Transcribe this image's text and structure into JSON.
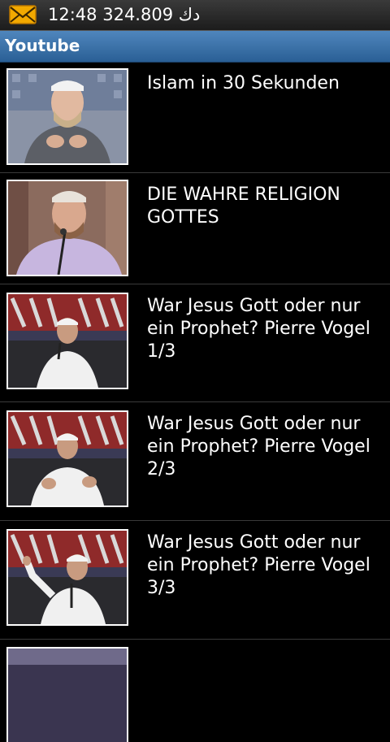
{
  "status_bar": {
    "time": "12:48",
    "extra": "دك 324.809",
    "notification_icon": "mail-icon"
  },
  "app": {
    "title": "Youtube"
  },
  "videos": [
    {
      "title": "Islam in 30 Sekunden"
    },
    {
      "title": "DIE WAHRE RELIGION GOTTES"
    },
    {
      "title": "War Jesus Gott oder nur ein Prophet? Pierre Vogel 1/3"
    },
    {
      "title": "War Jesus Gott oder nur ein Prophet? Pierre Vogel 2/3"
    },
    {
      "title": "War Jesus Gott oder nur ein Prophet? Pierre Vogel 3/3"
    }
  ]
}
